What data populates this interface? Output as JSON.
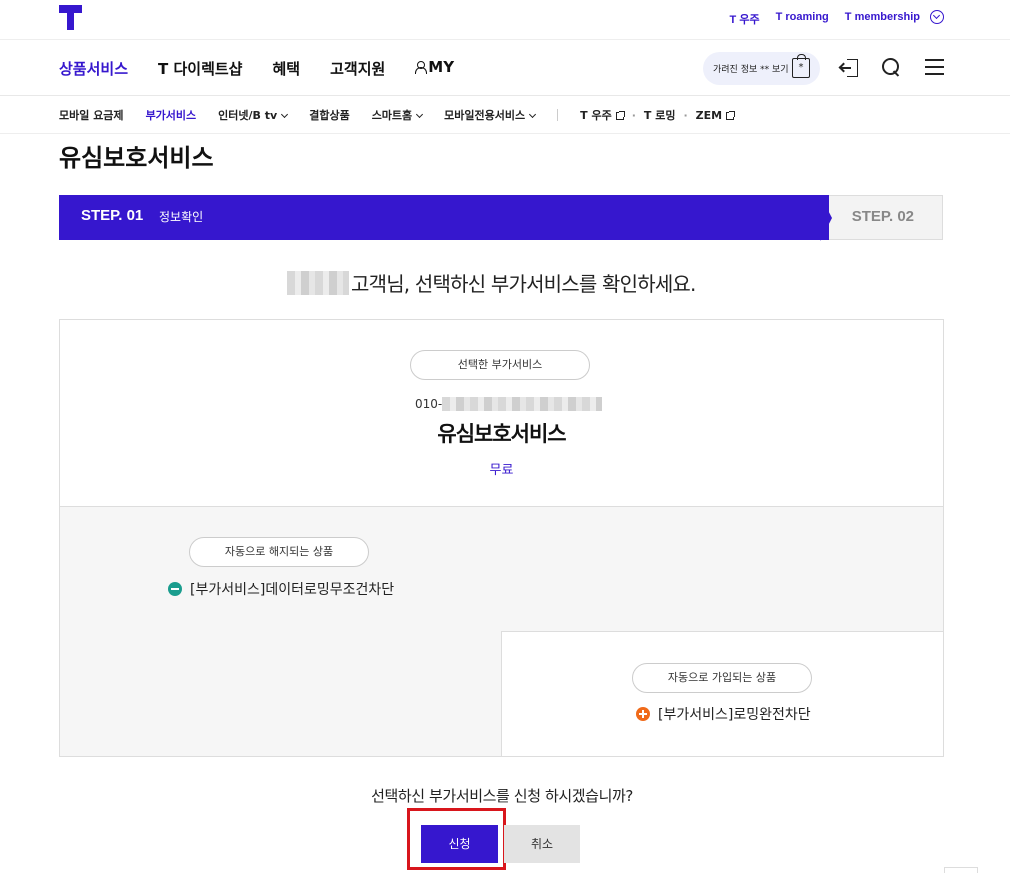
{
  "topbar": {
    "links": [
      {
        "mark": "T",
        "label": "우주"
      },
      {
        "mark": "T",
        "label": "roaming"
      },
      {
        "mark": "T",
        "label": "membership"
      }
    ]
  },
  "mainnav": {
    "items": [
      "상품서비스",
      "T 다이렉트샵",
      "혜택",
      "고객지원",
      "MY"
    ],
    "hidden_info_label": "가려진 정보 ** 보기",
    "hidden_info_icon_text": "*"
  },
  "subnav": {
    "items": [
      "모바일 요금제",
      "부가서비스",
      "인터넷/B tv",
      "결합상품",
      "스마트홈",
      "모바일전용서비스"
    ],
    "ext_items": [
      "T 우주",
      "T 로밍",
      "ZEM"
    ]
  },
  "page": {
    "title": "유심보호서비스",
    "step1_num": "STEP. 01",
    "step1_label": "정보확인",
    "step2_num": "STEP. 02",
    "greeting_suffix": "고객님, 선택하신 부가서비스를 확인하세요.",
    "selected_pill": "선택한 부가서비스",
    "phone_prefix": "010-",
    "service_name": "유심보호서비스",
    "price": "무료",
    "auto_cancel_pill": "자동으로 해지되는 상품",
    "auto_cancel_item": "[부가서비스]데이터로밍무조건차단",
    "auto_join_pill": "자동으로 가입되는 상품",
    "auto_join_item": "[부가서비스]로밍완전차단",
    "question": "선택하신 부가서비스를 신청 하시겠습니까?",
    "apply_button": "신청",
    "cancel_button": "취소"
  },
  "colors": {
    "brand": "#3617ce",
    "highlight_border": "#d8161c",
    "minus": "#1a9d8e",
    "plus": "#f06a1a"
  }
}
